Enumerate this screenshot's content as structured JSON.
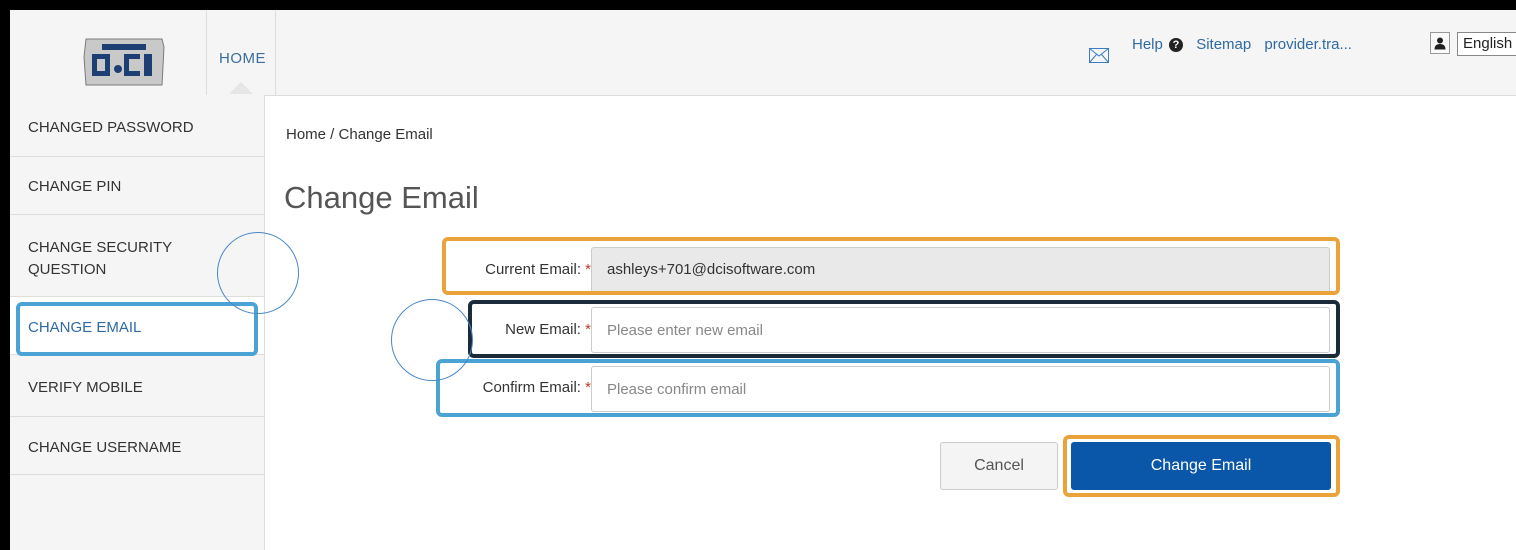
{
  "header": {
    "home_tab": "HOME",
    "help_link": "Help",
    "sitemap_link": "Sitemap",
    "user_link": "provider.tra...",
    "language": "English"
  },
  "sidebar": {
    "items": [
      {
        "label": "CHANGED PASSWORD"
      },
      {
        "label": "CHANGE PIN"
      },
      {
        "label": "CHANGE SECURITY QUESTION"
      },
      {
        "label": "CHANGE EMAIL"
      },
      {
        "label": "VERIFY MOBILE"
      },
      {
        "label": "CHANGE USERNAME"
      }
    ]
  },
  "breadcrumb": "Home / Change Email",
  "page_title": "Change Email",
  "form": {
    "current_email_label": "Current Email:",
    "current_email_value": "ashleys+701@dcisoftware.com",
    "new_email_label": "New Email:",
    "new_email_placeholder": "Please enter new email",
    "confirm_email_label": "Confirm Email:",
    "confirm_email_placeholder": "Please confirm email",
    "required_marker": "*"
  },
  "buttons": {
    "cancel": "Cancel",
    "submit": "Change Email"
  },
  "colors": {
    "highlight_orange": "#E9A33A",
    "highlight_blue": "#4AA3D4",
    "highlight_dark": "#1B2B3A",
    "primary_button": "#0A56A8",
    "link": "#2F6AA3"
  }
}
